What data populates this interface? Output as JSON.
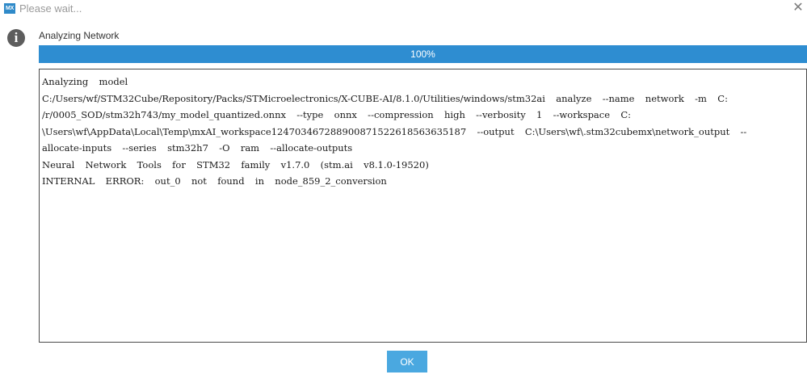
{
  "window": {
    "icon_text": "MX",
    "title": "Please wait...",
    "close_glyph": "✕"
  },
  "dialog": {
    "info_glyph": "i",
    "heading": "Analyzing Network",
    "progress": {
      "percent": 100,
      "label": "100%"
    },
    "log_lines": [
      "Analyzing  model",
      "C:/Users/wf/STM32Cube/Repository/Packs/STMicroelectronics/X-CUBE-AI/8.1.0/Utilities/windows/stm32ai  analyze  --name  network  -m  C:",
      "/r/0005_SOD/stm32h743/my_model_quantized.onnx  --type  onnx  --compression  high  --verbosity  1  --workspace  C:",
      "\\Users\\wf\\AppData\\Local\\Temp\\mxAI_workspace124703467288900871522618563635187  --output  C:\\Users\\wf\\.stm32cubemx\\network_output  --",
      "allocate-inputs  --series  stm32h7  -O  ram  --allocate-outputs",
      "Neural  Network  Tools  for  STM32  family  v1.7.0  (stm.ai  v8.1.0-19520)",
      "INTERNAL  ERROR:  out_0  not  found  in  node_859_2_conversion"
    ],
    "ok_label": "OK"
  },
  "colors": {
    "accent": "#2e8dd1",
    "button": "#4aa8e0",
    "app_icon": "#2f8ac9"
  },
  "icons": {
    "app": "stm32cubemx-logo-icon",
    "close": "close-icon",
    "info": "info-icon"
  }
}
